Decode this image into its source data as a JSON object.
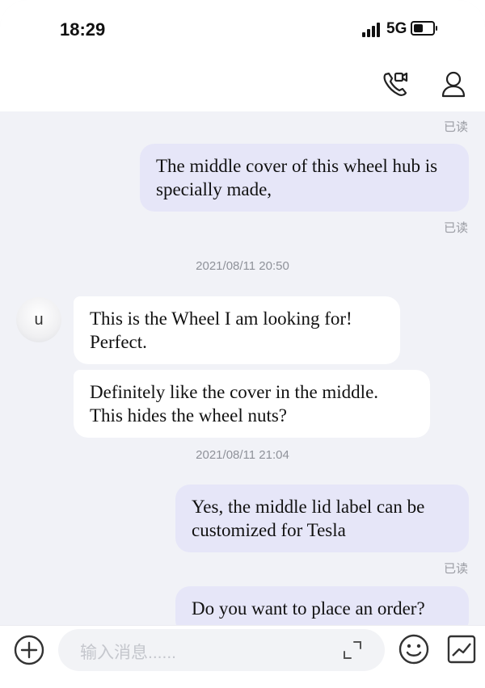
{
  "status_bar": {
    "time": "18:29",
    "network": "5G"
  },
  "header": {
    "video_call_icon": "video-call-icon",
    "profile_icon": "profile-icon"
  },
  "messages": {
    "read_label": "已读",
    "out_1": "The middle cover of this wheel hub is specially made,",
    "timestamp_1": "2021/08/11 20:50",
    "avatar_letter": "u",
    "in_1": "This is the Wheel I am looking for! Perfect.",
    "in_2": "Definitely like the cover in the middle. This hides the wheel nuts?",
    "timestamp_2": "2021/08/11 21:04",
    "out_2": "Yes, the middle lid label can be customized for Tesla",
    "out_3": "Do you want to place an order?"
  },
  "input_bar": {
    "placeholder": "输入消息......",
    "icons": [
      "add-icon",
      "expand-icon",
      "emoji-icon",
      "image-icon"
    ]
  },
  "colors": {
    "outgoing_bubble": "#e6e6f8",
    "incoming_bubble": "#ffffff",
    "background": "#f1f2f7"
  }
}
